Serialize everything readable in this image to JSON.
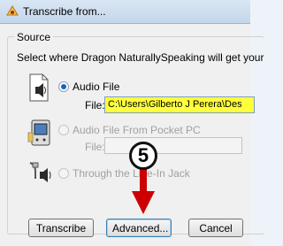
{
  "window": {
    "title": "Transcribe from..."
  },
  "source": {
    "group_label": "Source",
    "instruction": "Select where Dragon NaturallySpeaking will get your",
    "audio_file": {
      "label": "Audio File",
      "selected": true,
      "field_label": "File:",
      "field_value": "C:\\Users\\Gilberto J Perera\\Des"
    },
    "pocket_pc": {
      "label": "Audio File From Pocket PC",
      "selected": false,
      "field_label": "File:",
      "field_value": ""
    },
    "line_jack": {
      "label": "Through the Line-In Jack",
      "selected": false
    }
  },
  "buttons": {
    "transcribe": "Transcribe",
    "advanced": "Advanced...",
    "cancel": "Cancel"
  },
  "annotation": {
    "step_number": "5",
    "arrow_color": "#cc0000"
  }
}
